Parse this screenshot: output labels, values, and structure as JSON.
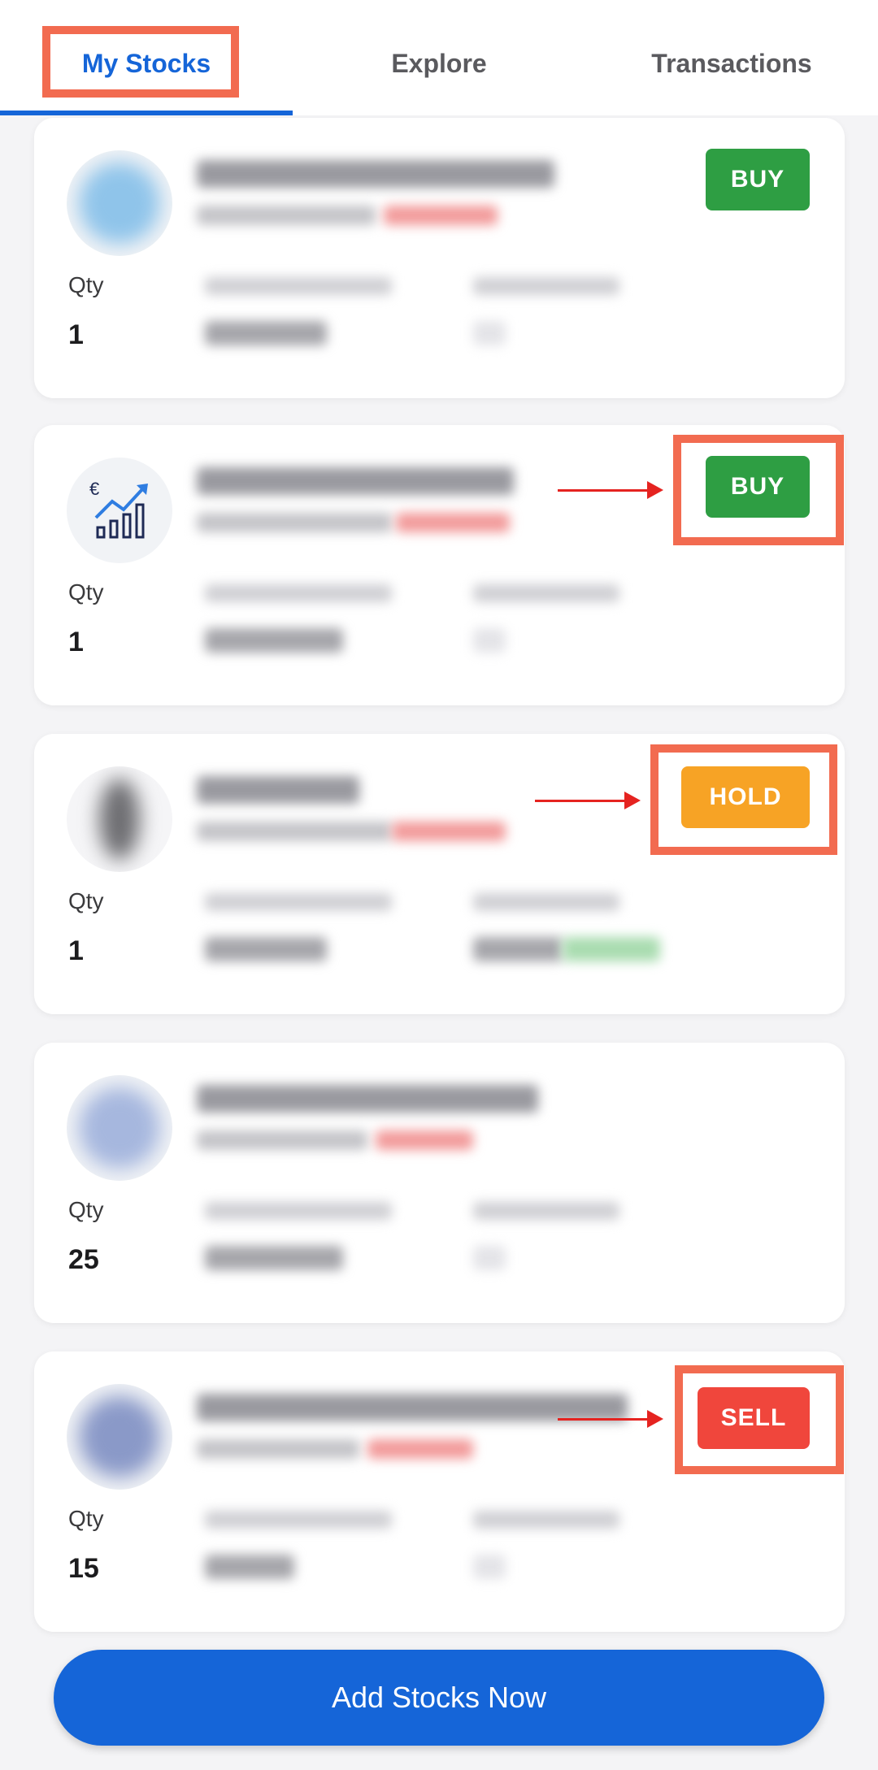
{
  "tabs": [
    {
      "label": "My Stocks",
      "active": true
    },
    {
      "label": "Explore",
      "active": false
    },
    {
      "label": "Transactions",
      "active": false
    }
  ],
  "qty_label": "Qty",
  "stocks": [
    {
      "qty": "1",
      "action": "BUY",
      "action_color": "#2e9e43"
    },
    {
      "qty": "1",
      "action": "BUY",
      "action_color": "#2e9e43"
    },
    {
      "qty": "1",
      "action": "HOLD",
      "action_color": "#f7a325"
    },
    {
      "qty": "25",
      "action": "",
      "action_color": ""
    },
    {
      "qty": "15",
      "action": "SELL",
      "action_color": "#f0463c"
    }
  ],
  "add_button_label": "Add Stocks Now",
  "colors": {
    "accent": "#1565d8",
    "annotation": "#f26b50",
    "arrow": "#e52320"
  }
}
